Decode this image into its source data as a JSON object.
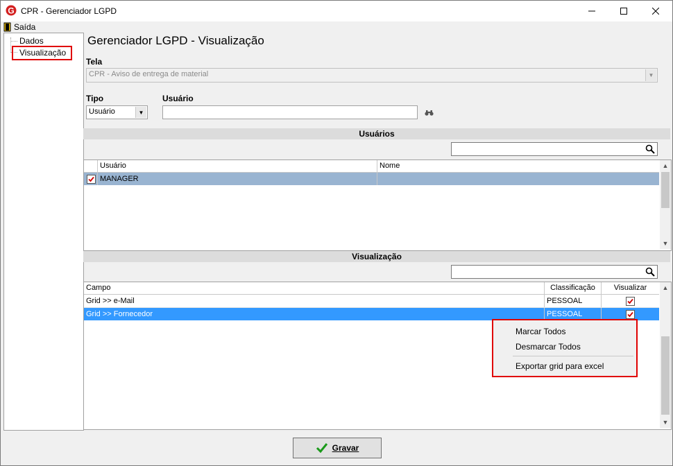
{
  "window": {
    "title": "CPR - Gerenciador LGPD",
    "app_icon_letter": "G"
  },
  "menubar": {
    "exit_label": "Saída"
  },
  "tree": {
    "items": [
      {
        "label": "Dados"
      },
      {
        "label": "Visualização"
      }
    ]
  },
  "page": {
    "heading": "Gerenciador LGPD - Visualização"
  },
  "tela": {
    "label": "Tela",
    "value": "CPR - Aviso de entrega de material"
  },
  "tipo": {
    "label": "Tipo",
    "value": "Usuário"
  },
  "usuario": {
    "label": "Usuário",
    "value": ""
  },
  "usuarios_section": {
    "title": "Usuários",
    "search_value": "",
    "columns": [
      "Usuário",
      "Nome"
    ],
    "rows": [
      {
        "usuario": "MANAGER",
        "nome": "",
        "checked": true
      }
    ]
  },
  "visualizacao_section": {
    "title": "Visualização",
    "search_value": "",
    "columns": [
      "Campo",
      "Classificação",
      "Visualizar"
    ],
    "rows": [
      {
        "campo": "Grid >> e-Mail",
        "classificacao": "PESSOAL",
        "visualizar": true
      },
      {
        "campo": "Grid >> Fornecedor",
        "classificacao": "PESSOAL",
        "visualizar": true
      }
    ]
  },
  "context_menu": {
    "items": [
      "Marcar Todos",
      "Desmarcar Todos",
      "Exportar grid para excel"
    ]
  },
  "footer": {
    "save_label": "Gravar"
  },
  "colors": {
    "selection_blue": "#3399ff",
    "selection_light": "#99b4d1",
    "highlight_red": "#e00000",
    "check_red": "#d00000"
  }
}
